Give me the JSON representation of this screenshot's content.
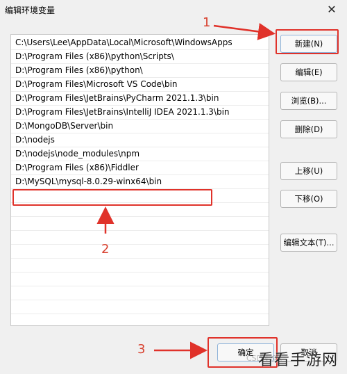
{
  "window": {
    "title": "编辑环境变量",
    "close_glyph": "✕"
  },
  "paths": [
    "C:\\Users\\Lee\\AppData\\Local\\Microsoft\\WindowsApps",
    "D:\\Program Files (x86)\\python\\Scripts\\",
    "D:\\Program Files (x86)\\python\\",
    "D:\\Program Files\\Microsoft VS Code\\bin",
    "D:\\Program Files\\JetBrains\\PyCharm 2021.1.3\\bin",
    "D:\\Program Files\\JetBrains\\IntelliJ IDEA 2021.1.3\\bin",
    "D:\\MongoDB\\Server\\bin",
    "D:\\nodejs",
    "D:\\nodejs\\node_modules\\npm",
    "D:\\Program Files (x86)\\Fiddler",
    "D:\\MySQL\\mysql-8.0.29-winx64\\bin",
    ""
  ],
  "buttons": {
    "new": "新建(N)",
    "edit": "编辑(E)",
    "browse": "浏览(B)...",
    "delete": "删除(D)",
    "move_up": "上移(U)",
    "move_down": "下移(O)",
    "edit_text": "编辑文本(T)...",
    "ok": "确定",
    "cancel": "取消"
  },
  "annotations": {
    "step1": "1",
    "step2": "2",
    "step3": "3",
    "color": "#e0322a"
  },
  "watermark": {
    "text": "看看手游网",
    "faint": "CSDN @"
  }
}
